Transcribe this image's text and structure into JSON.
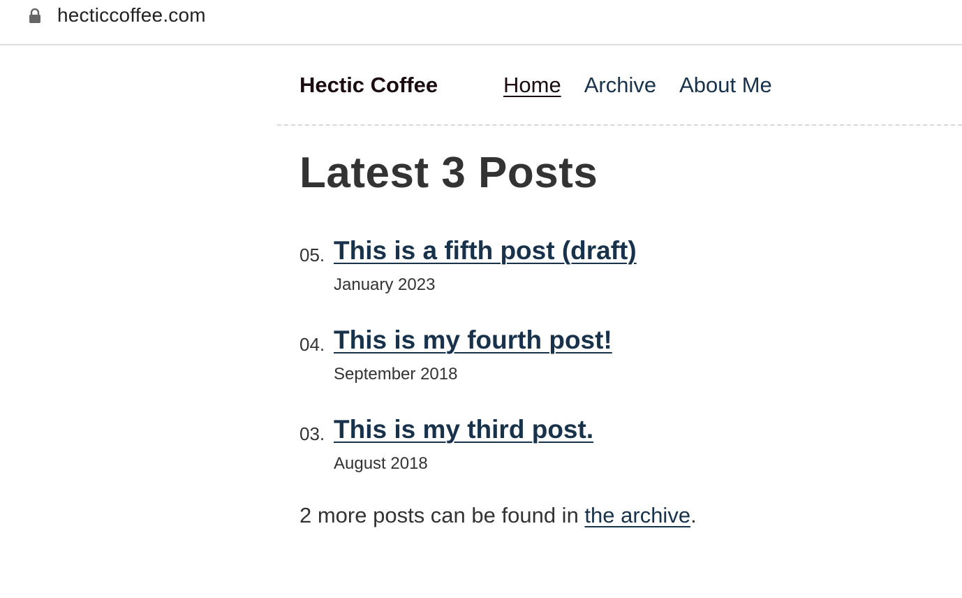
{
  "browser": {
    "url": "hecticcoffee.com",
    "lock_icon": "lock-icon"
  },
  "header": {
    "site_title": "Hectic Coffee",
    "nav": [
      {
        "label": "Home",
        "active": true
      },
      {
        "label": "Archive",
        "active": false
      },
      {
        "label": "About Me",
        "active": false
      }
    ]
  },
  "main": {
    "title": "Latest 3 Posts",
    "posts": [
      {
        "number": "05.",
        "title": "This is a fifth post (draft)",
        "date": "January 2023"
      },
      {
        "number": "04.",
        "title": "This is my fourth post!",
        "date": "September 2018"
      },
      {
        "number": "03.",
        "title": "This is my third post.",
        "date": "August 2018"
      }
    ],
    "more_prefix": "2 more posts can be found in ",
    "more_link": "the archive",
    "more_suffix": "."
  },
  "colors": {
    "link": "#17324a",
    "text": "#333333",
    "title": "#1a0c10"
  }
}
